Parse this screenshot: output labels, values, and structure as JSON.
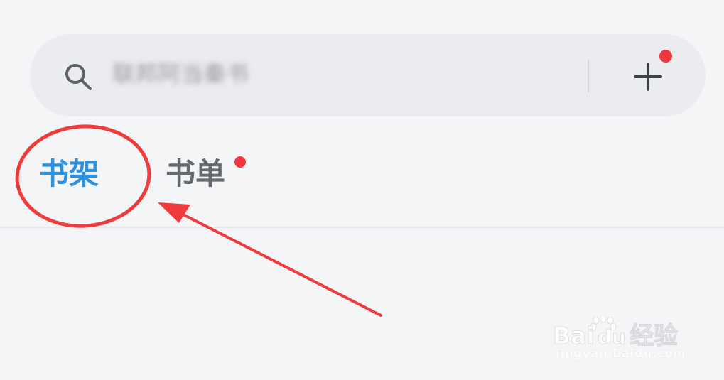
{
  "search": {
    "query": "联邦阿当秦书",
    "icon": "search-icon"
  },
  "header": {
    "add_icon": "plus-icon",
    "has_badge": true
  },
  "tabs": [
    {
      "label": "书架",
      "active": true
    },
    {
      "label": "书单",
      "active": false,
      "has_badge": true
    }
  ],
  "annotation": {
    "color": "#ee3b3b",
    "shapes": [
      "circle-highlight",
      "arrow"
    ]
  },
  "watermark": {
    "logo": "Baidu经验",
    "url": "jingyan.baidu.com"
  },
  "colors": {
    "active_tab": "#2a92df",
    "inactive_tab": "#66696e",
    "badge": "#f0353f",
    "background": "#f4f5f7",
    "search_bar": "#ebecef"
  }
}
